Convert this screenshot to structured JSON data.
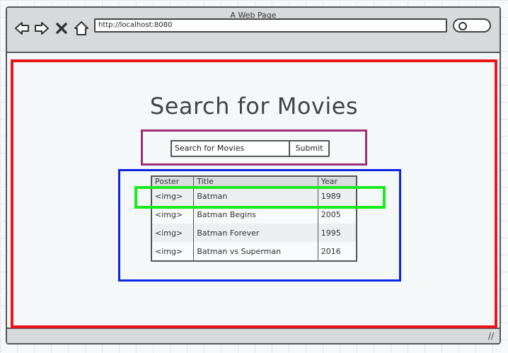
{
  "window": {
    "title": "A Web Page",
    "url": "http://localhost:8080"
  },
  "page": {
    "heading": "Search for Movies",
    "search": {
      "placeholder": "Search for Movies",
      "submit_label": "Submit"
    },
    "table": {
      "headers": [
        "Poster",
        "Title",
        "Year"
      ],
      "rows": [
        {
          "poster": "<img>",
          "title": "Batman",
          "year": "1989"
        },
        {
          "poster": "<img>",
          "title": "Batman Begins",
          "year": "2005"
        },
        {
          "poster": "<img>",
          "title": "Batman Forever",
          "year": "1995"
        },
        {
          "poster": "<img>",
          "title": "Batman vs Superman",
          "year": "2016"
        }
      ]
    }
  },
  "annotations": {
    "content_color": "#e8161b",
    "form_color": "#9d2f74",
    "table_color": "#0a24e0",
    "row_color": "#18ea1b"
  },
  "icons": [
    "back-arrow-icon",
    "forward-arrow-icon",
    "close-icon",
    "home-icon",
    "search-icon",
    "resize-grip-icon"
  ]
}
